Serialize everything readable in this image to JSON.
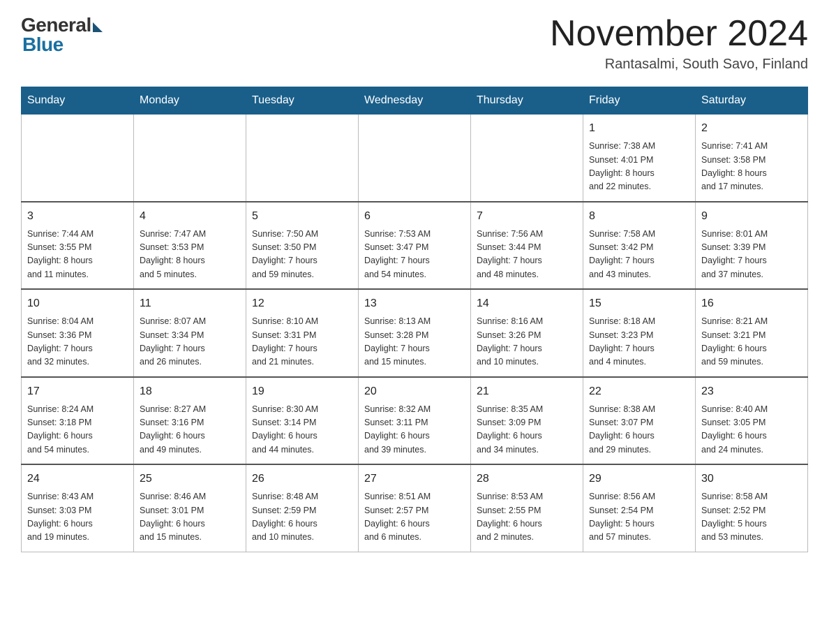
{
  "header": {
    "logo_general": "General",
    "logo_blue": "Blue",
    "month_title": "November 2024",
    "location": "Rantasalmi, South Savo, Finland"
  },
  "weekdays": [
    "Sunday",
    "Monday",
    "Tuesday",
    "Wednesday",
    "Thursday",
    "Friday",
    "Saturday"
  ],
  "weeks": [
    [
      {
        "day": "",
        "info": ""
      },
      {
        "day": "",
        "info": ""
      },
      {
        "day": "",
        "info": ""
      },
      {
        "day": "",
        "info": ""
      },
      {
        "day": "",
        "info": ""
      },
      {
        "day": "1",
        "info": "Sunrise: 7:38 AM\nSunset: 4:01 PM\nDaylight: 8 hours\nand 22 minutes."
      },
      {
        "day": "2",
        "info": "Sunrise: 7:41 AM\nSunset: 3:58 PM\nDaylight: 8 hours\nand 17 minutes."
      }
    ],
    [
      {
        "day": "3",
        "info": "Sunrise: 7:44 AM\nSunset: 3:55 PM\nDaylight: 8 hours\nand 11 minutes."
      },
      {
        "day": "4",
        "info": "Sunrise: 7:47 AM\nSunset: 3:53 PM\nDaylight: 8 hours\nand 5 minutes."
      },
      {
        "day": "5",
        "info": "Sunrise: 7:50 AM\nSunset: 3:50 PM\nDaylight: 7 hours\nand 59 minutes."
      },
      {
        "day": "6",
        "info": "Sunrise: 7:53 AM\nSunset: 3:47 PM\nDaylight: 7 hours\nand 54 minutes."
      },
      {
        "day": "7",
        "info": "Sunrise: 7:56 AM\nSunset: 3:44 PM\nDaylight: 7 hours\nand 48 minutes."
      },
      {
        "day": "8",
        "info": "Sunrise: 7:58 AM\nSunset: 3:42 PM\nDaylight: 7 hours\nand 43 minutes."
      },
      {
        "day": "9",
        "info": "Sunrise: 8:01 AM\nSunset: 3:39 PM\nDaylight: 7 hours\nand 37 minutes."
      }
    ],
    [
      {
        "day": "10",
        "info": "Sunrise: 8:04 AM\nSunset: 3:36 PM\nDaylight: 7 hours\nand 32 minutes."
      },
      {
        "day": "11",
        "info": "Sunrise: 8:07 AM\nSunset: 3:34 PM\nDaylight: 7 hours\nand 26 minutes."
      },
      {
        "day": "12",
        "info": "Sunrise: 8:10 AM\nSunset: 3:31 PM\nDaylight: 7 hours\nand 21 minutes."
      },
      {
        "day": "13",
        "info": "Sunrise: 8:13 AM\nSunset: 3:28 PM\nDaylight: 7 hours\nand 15 minutes."
      },
      {
        "day": "14",
        "info": "Sunrise: 8:16 AM\nSunset: 3:26 PM\nDaylight: 7 hours\nand 10 minutes."
      },
      {
        "day": "15",
        "info": "Sunrise: 8:18 AM\nSunset: 3:23 PM\nDaylight: 7 hours\nand 4 minutes."
      },
      {
        "day": "16",
        "info": "Sunrise: 8:21 AM\nSunset: 3:21 PM\nDaylight: 6 hours\nand 59 minutes."
      }
    ],
    [
      {
        "day": "17",
        "info": "Sunrise: 8:24 AM\nSunset: 3:18 PM\nDaylight: 6 hours\nand 54 minutes."
      },
      {
        "day": "18",
        "info": "Sunrise: 8:27 AM\nSunset: 3:16 PM\nDaylight: 6 hours\nand 49 minutes."
      },
      {
        "day": "19",
        "info": "Sunrise: 8:30 AM\nSunset: 3:14 PM\nDaylight: 6 hours\nand 44 minutes."
      },
      {
        "day": "20",
        "info": "Sunrise: 8:32 AM\nSunset: 3:11 PM\nDaylight: 6 hours\nand 39 minutes."
      },
      {
        "day": "21",
        "info": "Sunrise: 8:35 AM\nSunset: 3:09 PM\nDaylight: 6 hours\nand 34 minutes."
      },
      {
        "day": "22",
        "info": "Sunrise: 8:38 AM\nSunset: 3:07 PM\nDaylight: 6 hours\nand 29 minutes."
      },
      {
        "day": "23",
        "info": "Sunrise: 8:40 AM\nSunset: 3:05 PM\nDaylight: 6 hours\nand 24 minutes."
      }
    ],
    [
      {
        "day": "24",
        "info": "Sunrise: 8:43 AM\nSunset: 3:03 PM\nDaylight: 6 hours\nand 19 minutes."
      },
      {
        "day": "25",
        "info": "Sunrise: 8:46 AM\nSunset: 3:01 PM\nDaylight: 6 hours\nand 15 minutes."
      },
      {
        "day": "26",
        "info": "Sunrise: 8:48 AM\nSunset: 2:59 PM\nDaylight: 6 hours\nand 10 minutes."
      },
      {
        "day": "27",
        "info": "Sunrise: 8:51 AM\nSunset: 2:57 PM\nDaylight: 6 hours\nand 6 minutes."
      },
      {
        "day": "28",
        "info": "Sunrise: 8:53 AM\nSunset: 2:55 PM\nDaylight: 6 hours\nand 2 minutes."
      },
      {
        "day": "29",
        "info": "Sunrise: 8:56 AM\nSunset: 2:54 PM\nDaylight: 5 hours\nand 57 minutes."
      },
      {
        "day": "30",
        "info": "Sunrise: 8:58 AM\nSunset: 2:52 PM\nDaylight: 5 hours\nand 53 minutes."
      }
    ]
  ]
}
